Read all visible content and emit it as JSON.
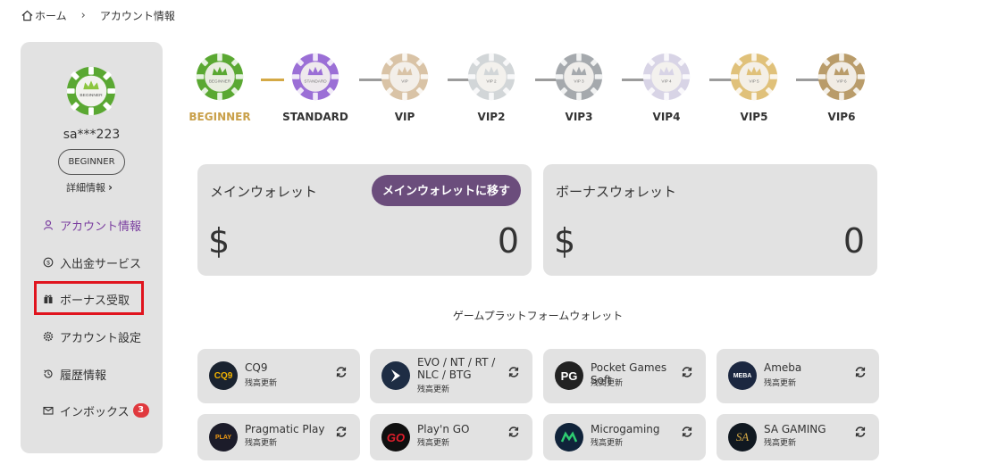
{
  "breadcrumb": {
    "home": "ホーム",
    "current": "アカウント情報"
  },
  "sidebar": {
    "username": "sa***223",
    "level": "BEGINNER",
    "detail_link": "詳細情報",
    "menu": [
      {
        "label": "アカウント情報",
        "icon": "user-icon",
        "active": true
      },
      {
        "label": "入出金サービス",
        "icon": "coin-icon"
      },
      {
        "label": "ボーナス受取",
        "icon": "gift-icon"
      },
      {
        "label": "アカウント設定",
        "icon": "gear-icon"
      },
      {
        "label": "履歴情報",
        "icon": "history-icon"
      },
      {
        "label": "インボックス",
        "icon": "mail-icon",
        "badge": "3"
      }
    ]
  },
  "tiers": {
    "items": [
      {
        "label": "BEGINNER",
        "chip_text": "BEGINNER",
        "color": "#5aa832"
      },
      {
        "label": "STANDARD",
        "chip_text": "STANDARD",
        "color": "#9b6fd6"
      },
      {
        "label": "VIP",
        "chip_text": "VIP",
        "color": "#d9c3a6"
      },
      {
        "label": "VIP2",
        "chip_text": "VIP 2",
        "color": "#d2d6d8"
      },
      {
        "label": "VIP3",
        "chip_text": "VIP 3",
        "color": "#a5a9ad"
      },
      {
        "label": "VIP4",
        "chip_text": "VIP 4",
        "color": "#d8d4e6"
      },
      {
        "label": "VIP5",
        "chip_text": "VIP 5",
        "color": "#e0c17a"
      },
      {
        "label": "VIP6",
        "chip_text": "VIP 6",
        "color": "#b99c6a"
      }
    ]
  },
  "wallets": {
    "main": {
      "title": "メインウォレット",
      "currency": "$",
      "amount": "0",
      "button": "メインウォレットに移す"
    },
    "bonus": {
      "title": "ボーナスウォレット",
      "currency": "$",
      "amount": "0"
    }
  },
  "platforms": {
    "title": "ゲームプラットフォームウォレット",
    "status": "残高更新",
    "items": [
      {
        "name": "CQ9",
        "logo": "CQ9"
      },
      {
        "name": "EVO / NT / RT / NLC / BTG",
        "logo": "EVO"
      },
      {
        "name": "Pocket Games Soft",
        "logo": "PG"
      },
      {
        "name": "Ameba",
        "logo": "MEBA"
      },
      {
        "name": "Pragmatic Play",
        "logo": "PLAY"
      },
      {
        "name": "Play'n GO",
        "logo": "GO"
      },
      {
        "name": "Microgaming",
        "logo": "M"
      },
      {
        "name": "SA GAMING",
        "logo": "SA"
      }
    ]
  },
  "colors": {
    "accent": "#7b3fa0",
    "gold": "#c9a04a",
    "highlight": "#e0141e",
    "button": "#6b4d7c"
  }
}
